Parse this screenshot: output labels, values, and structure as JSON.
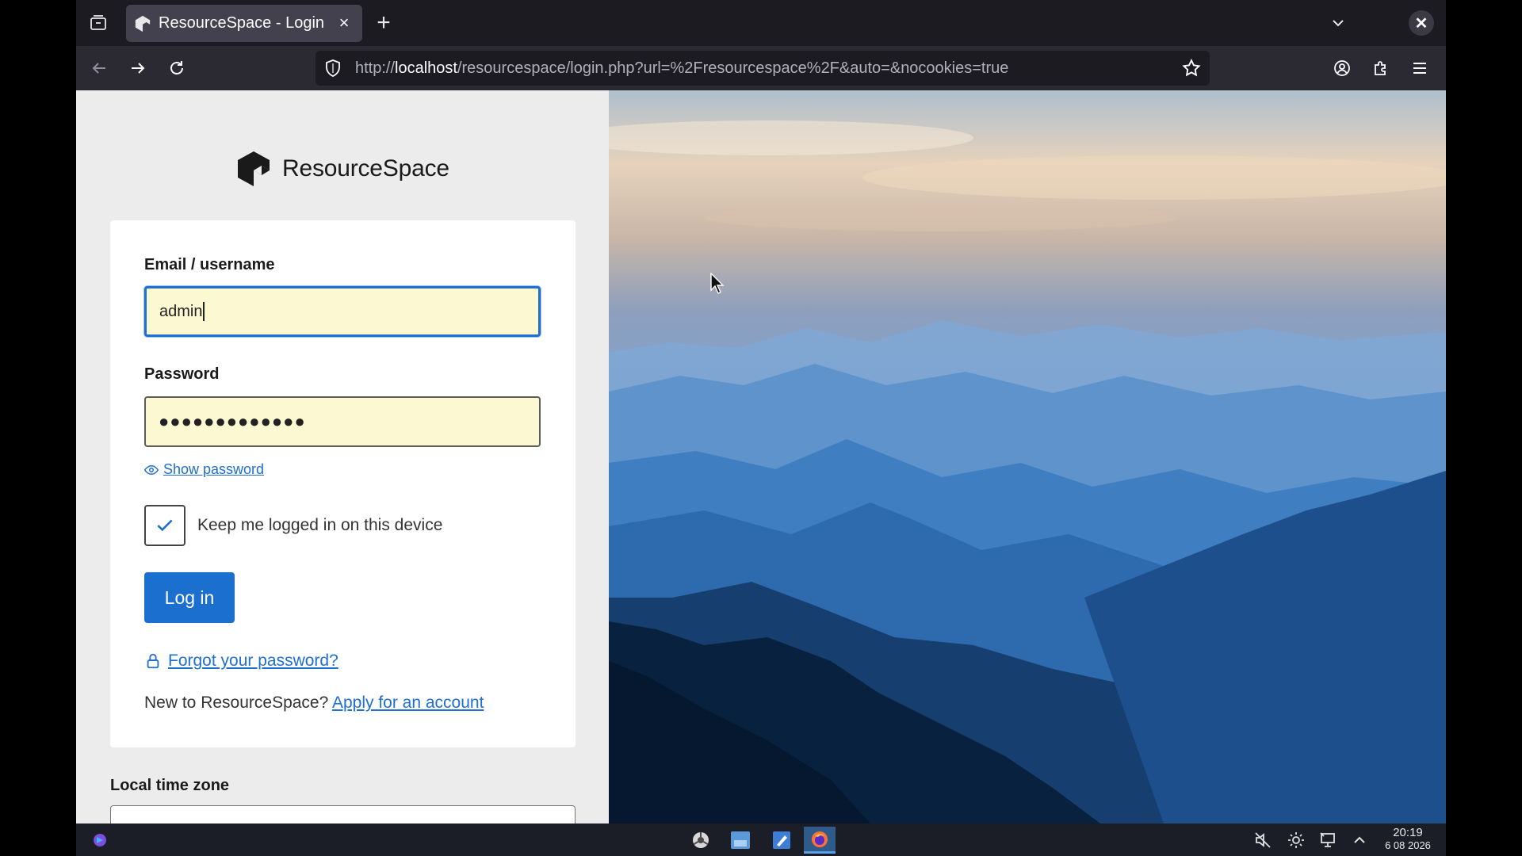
{
  "browser": {
    "tab_title": "ResourceSpace - Login",
    "tab_close": "×",
    "new_tab": "+",
    "url_prefix": "http://",
    "url_host": "localhost",
    "url_path": "/resourcespace/login.php?url=%2Fresourcespace%2F&auto=&nocookies=true"
  },
  "page": {
    "logo_text": "ResourceSpace",
    "username_label": "Email / username",
    "username_value": "admin",
    "password_label": "Password",
    "password_value": "●●●●●●●●●●●●●",
    "show_password": "Show password",
    "keep_logged_in": "Keep me logged in on this device",
    "keep_logged_in_checked": true,
    "login_button": "Log in",
    "forgot_password": "Forgot your password?",
    "new_account_prefix": "New to ResourceSpace? ",
    "apply_link": "Apply for an account",
    "timezone_label": "Local time zone",
    "accent_color": "#1a6fcf"
  },
  "taskbar": {
    "time": "20:19",
    "date": "6 08 2026"
  },
  "icons": [
    "tab-list-icon",
    "resourcespace-favicon",
    "chevron-down-icon",
    "back-arrow-icon",
    "forward-arrow-icon",
    "reload-icon",
    "shield-icon",
    "star-icon",
    "account-icon",
    "extensions-icon",
    "hamburger-menu-icon",
    "eye-icon",
    "checkmark-icon",
    "lock-icon",
    "speaker-muted-icon",
    "brightness-icon",
    "network-icon",
    "chevron-up-icon"
  ]
}
